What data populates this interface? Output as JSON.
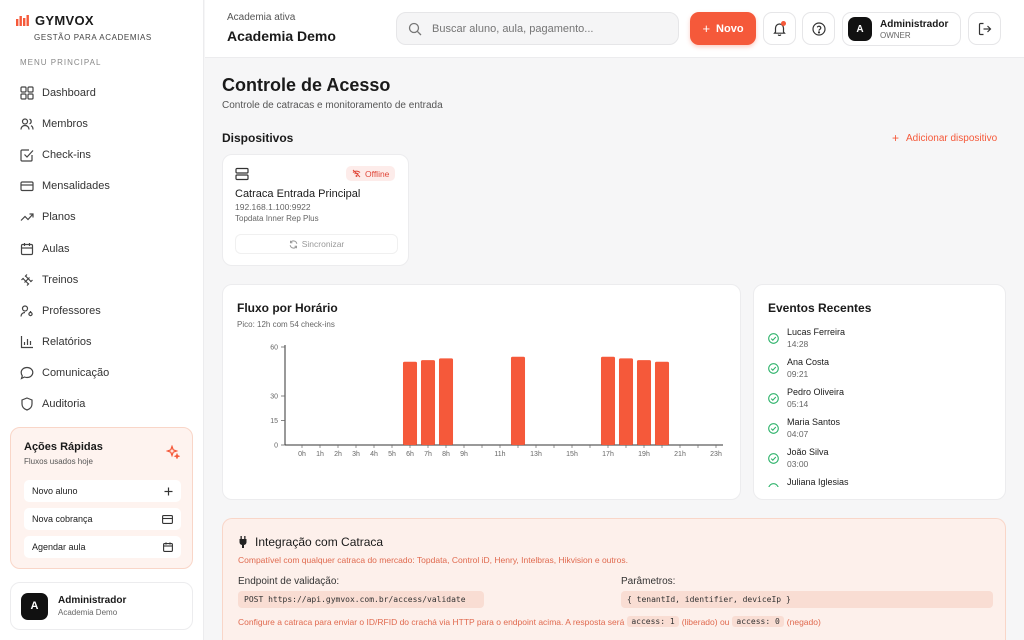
{
  "brand": {
    "name": "GYMVOX",
    "subtitle": "GESTÃO PARA ACADEMIAS",
    "accent": "#f5593a"
  },
  "sidebar": {
    "menu_title": "MENU PRINCIPAL",
    "items": [
      {
        "label": "Dashboard",
        "icon": "grid-icon"
      },
      {
        "label": "Membros",
        "icon": "users-icon"
      },
      {
        "label": "Check-ins",
        "icon": "checkbox-icon"
      },
      {
        "label": "Mensalidades",
        "icon": "card-icon"
      },
      {
        "label": "Planos",
        "icon": "trend-icon"
      },
      {
        "label": "Aulas",
        "icon": "calendar-icon"
      },
      {
        "label": "Treinos",
        "icon": "dumbbell-icon"
      },
      {
        "label": "Professores",
        "icon": "user-key-icon"
      },
      {
        "label": "Relatórios",
        "icon": "bar-chart-icon"
      },
      {
        "label": "Comunicação",
        "icon": "message-icon"
      },
      {
        "label": "Auditoria",
        "icon": "shield-icon"
      }
    ],
    "quick": {
      "title": "Ações Rápidas",
      "subtitle": "Fluxos usados hoje",
      "actions": [
        {
          "label": "Novo aluno",
          "icon": "plus-icon"
        },
        {
          "label": "Nova cobrança",
          "icon": "card-icon"
        },
        {
          "label": "Agendar aula",
          "icon": "calendar-icon"
        }
      ]
    },
    "user": {
      "initial": "A",
      "name": "Administrador",
      "org": "Academia Demo"
    }
  },
  "header": {
    "label": "Academia ativa",
    "title": "Academia Demo",
    "search_placeholder": "Buscar aluno, aula, pagamento...",
    "new_label": "Novo",
    "admin": {
      "initial": "A",
      "name": "Administrador",
      "role": "OWNER"
    }
  },
  "page": {
    "title": "Controle de Acesso",
    "subtitle": "Controle de catracas e monitoramento de entrada",
    "devices_title": "Dispositivos",
    "add_device": "Adicionar dispositivo"
  },
  "device": {
    "status": "Offline",
    "name": "Catraca Entrada Principal",
    "ip": "192.168.1.100:9922",
    "model": "Topdata Inner Rep Plus",
    "sync_label": "Sincronizar",
    "status_color": "#e0483a"
  },
  "flow": {
    "title": "Fluxo por Horário",
    "subtitle": "Pico: 12h com 54 check-ins"
  },
  "chart_data": {
    "type": "bar",
    "categories": [
      "0h",
      "1h",
      "2h",
      "3h",
      "4h",
      "5h",
      "6h",
      "7h",
      "8h",
      "9h",
      "10h",
      "11h",
      "12h",
      "13h",
      "14h",
      "15h",
      "16h",
      "17h",
      "18h",
      "19h",
      "20h",
      "21h",
      "22h",
      "23h"
    ],
    "tick_labels": [
      "0h",
      "1h",
      "2h",
      "3h",
      "4h",
      "5h",
      "6h",
      "7h",
      "8h",
      "9h",
      "",
      "11h",
      "",
      "13h",
      "",
      "15h",
      "",
      "17h",
      "",
      "19h",
      "",
      "21h",
      "",
      "23h"
    ],
    "values": [
      0,
      0,
      0,
      0,
      0,
      0,
      51,
      52,
      53,
      0,
      0,
      0,
      54,
      0,
      0,
      0,
      0,
      54,
      53,
      52,
      51,
      0,
      0,
      0
    ],
    "yticks": [
      0,
      15,
      30,
      60
    ],
    "ylim": [
      0,
      60
    ],
    "color": "#f5593a"
  },
  "events": {
    "title": "Eventos Recentes",
    "items": [
      {
        "name": "Lucas Ferreira",
        "time": "14:28"
      },
      {
        "name": "Ana Costa",
        "time": "09:21"
      },
      {
        "name": "Pedro Oliveira",
        "time": "05:14"
      },
      {
        "name": "Maria Santos",
        "time": "04:07"
      },
      {
        "name": "João Silva",
        "time": "03:00"
      },
      {
        "name": "Juliana Iglesias",
        "time": ""
      }
    ],
    "ok_color": "#2eb36b"
  },
  "integration": {
    "title": "Integração com Catraca",
    "subtitle": "Compatível com qualquer catraca do mercado: Topdata, Control iD, Henry, Intelbras, Hikvision e outros.",
    "endpoint_label": "Endpoint de validação:",
    "endpoint": "POST https://api.gymvox.com.br/access/validate",
    "params_label": "Parâmetros:",
    "params": "{ tenantId, identifier, deviceIp }",
    "note_1": "Configure a catraca para enviar o ID/RFID do crachá via HTTP para o endpoint acima. A resposta será",
    "code_ok": "access: 1",
    "note_2": "(liberado) ou",
    "code_denied": "access: 0",
    "note_3": "(negado)"
  }
}
